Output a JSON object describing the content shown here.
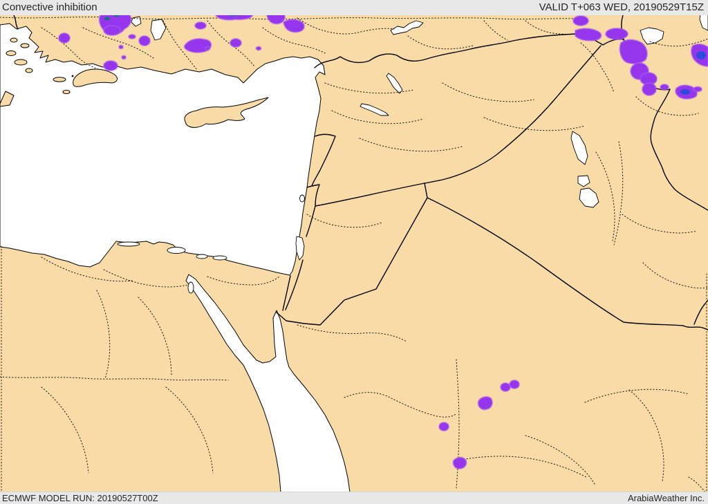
{
  "header": {
    "title": "Convective inhibition",
    "valid": "VALID T+063 WED, 20190529T15Z"
  },
  "footer": {
    "model_run": "ECMWF MODEL RUN: 20190527T00Z",
    "company": "ArabiaWeather Inc."
  },
  "map_meta": {
    "parameter": "Convective inhibition",
    "model": "ECMWF",
    "overlay_legend": "purple-shading-convective-inhibition-areas"
  },
  "colors": {
    "land": "#f8dba6",
    "sea": "#ffffff",
    "outline": "#000000",
    "border": "#000000",
    "purple": "#9636ec",
    "purple_soft": "#a95ef2",
    "blue_core": "#2e4bdb",
    "teal_core": "#16707c",
    "bar_bg": "#e8e8e8",
    "bar_text": "#262626"
  }
}
